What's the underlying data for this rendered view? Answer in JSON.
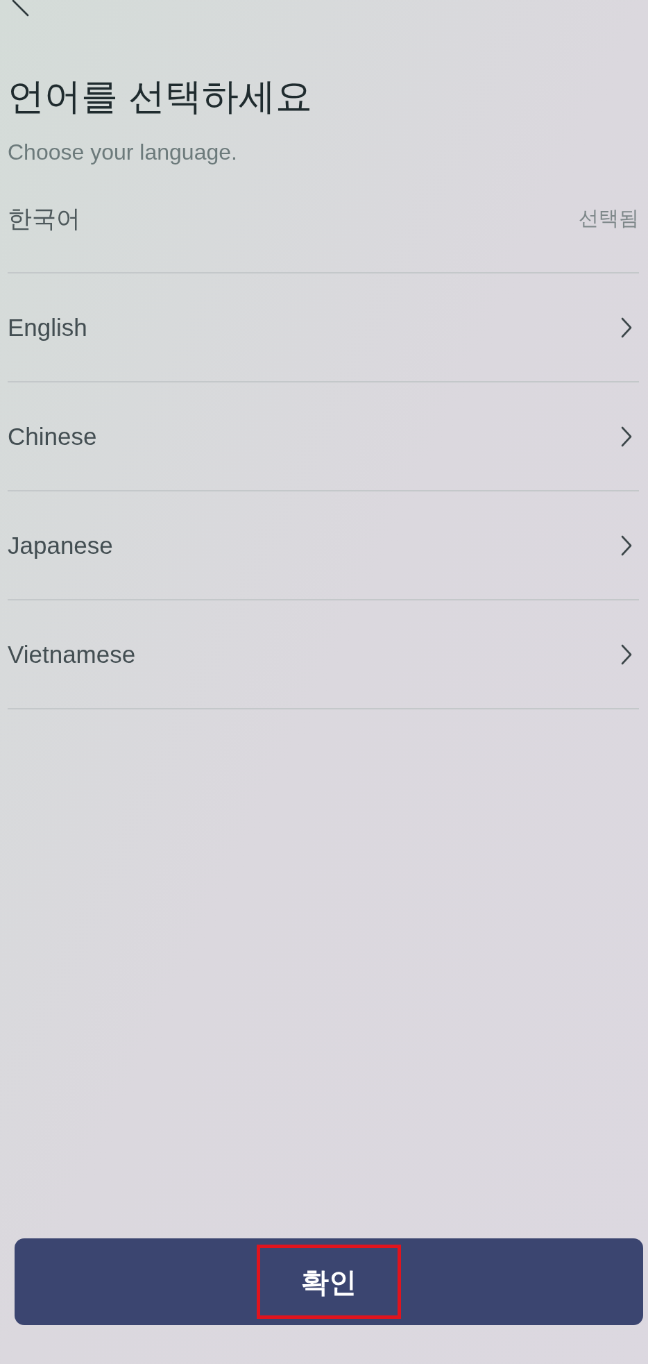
{
  "header": {
    "title": "언어를 선택하세요",
    "subtitle": "Choose your language."
  },
  "languages": [
    {
      "label": "한국어",
      "selected": true,
      "status": "선택됨"
    },
    {
      "label": "English",
      "selected": false
    },
    {
      "label": "Chinese",
      "selected": false
    },
    {
      "label": "Japanese",
      "selected": false
    },
    {
      "label": "Vietnamese",
      "selected": false
    }
  ],
  "confirm_button": {
    "label": "확인",
    "highlighted": true
  }
}
